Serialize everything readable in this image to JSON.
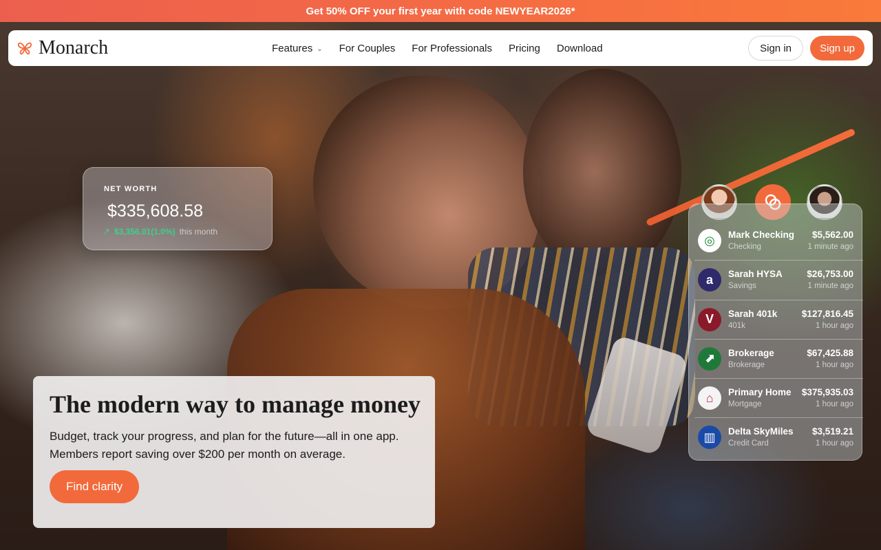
{
  "promo": {
    "text": "Get 50% OFF your first year with code NEWYEAR2026*"
  },
  "nav": {
    "brand": "Monarch",
    "links": [
      {
        "label": "Features",
        "has_dropdown": true
      },
      {
        "label": "For Couples"
      },
      {
        "label": "For Professionals"
      },
      {
        "label": "Pricing"
      },
      {
        "label": "Download"
      }
    ],
    "sign_in": "Sign in",
    "sign_up": "Sign up"
  },
  "net_worth": {
    "label": "NET WORTH",
    "value": "$335,608.58",
    "change": "$3,356.01(1.0%)",
    "period": "this month"
  },
  "accounts": [
    {
      "name": "Mark Checking",
      "type": "Checking",
      "amount": "$5,562.00",
      "updated": "1 minute ago",
      "icon": "bank-circle-icon",
      "icon_glyph": "◎",
      "icon_color": "#1f8a3a"
    },
    {
      "name": "Sarah HYSA",
      "type": "Savings",
      "amount": "$26,753.00",
      "updated": "1 minute ago",
      "icon": "letter-a-icon",
      "icon_glyph": "a",
      "icon_color": "#2f2a6b"
    },
    {
      "name": "Sarah 401k",
      "type": "401k",
      "amount": "$127,816.45",
      "updated": "1 hour ago",
      "icon": "letter-v-icon",
      "icon_glyph": "V",
      "icon_color": "#8a1a2a"
    },
    {
      "name": "Brokerage",
      "type": "Brokerage",
      "amount": "$67,425.88",
      "updated": "1 hour ago",
      "icon": "chart-arrow-icon",
      "icon_glyph": "⬈",
      "icon_color": "#1f7a3a"
    },
    {
      "name": "Primary Home",
      "type": "Mortgage",
      "amount": "$375,935.03",
      "updated": "1 hour ago",
      "icon": "house-icon",
      "icon_glyph": "⌂",
      "icon_color": "#f4f4f4"
    },
    {
      "name": "Delta SkyMiles",
      "type": "Credit Card",
      "amount": "$3,519.21",
      "updated": "1 hour ago",
      "icon": "card-icon",
      "icon_glyph": "▥",
      "icon_color": "#1a4aa8"
    }
  ],
  "hero": {
    "title": "The modern way to manage money",
    "body": "Budget, track your progress, and plan for the future—all in one app. Members report saving over $200 per month on average.",
    "cta": "Find clarity"
  },
  "colors": {
    "accent": "#f26a3b",
    "positive": "#3ecf8e"
  }
}
